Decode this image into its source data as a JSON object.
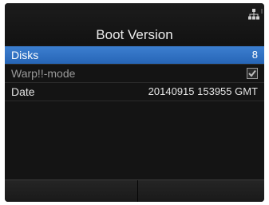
{
  "header": {
    "title": "Boot Version",
    "status_icon": "network-icon"
  },
  "rows": [
    {
      "label": "Disks",
      "value": "8",
      "selected": true
    },
    {
      "label": "Warp!!-mode",
      "checked": true,
      "disabled": true
    },
    {
      "label": "Date",
      "value": "20140915 153955 GMT"
    }
  ],
  "softkeys": {
    "left_label": "",
    "right_label": ""
  },
  "colors": {
    "screen_background": "#141414",
    "selection_highlight": "#3173c4",
    "text": "#e4e4e4",
    "disabled_text": "#9a9a9a"
  }
}
